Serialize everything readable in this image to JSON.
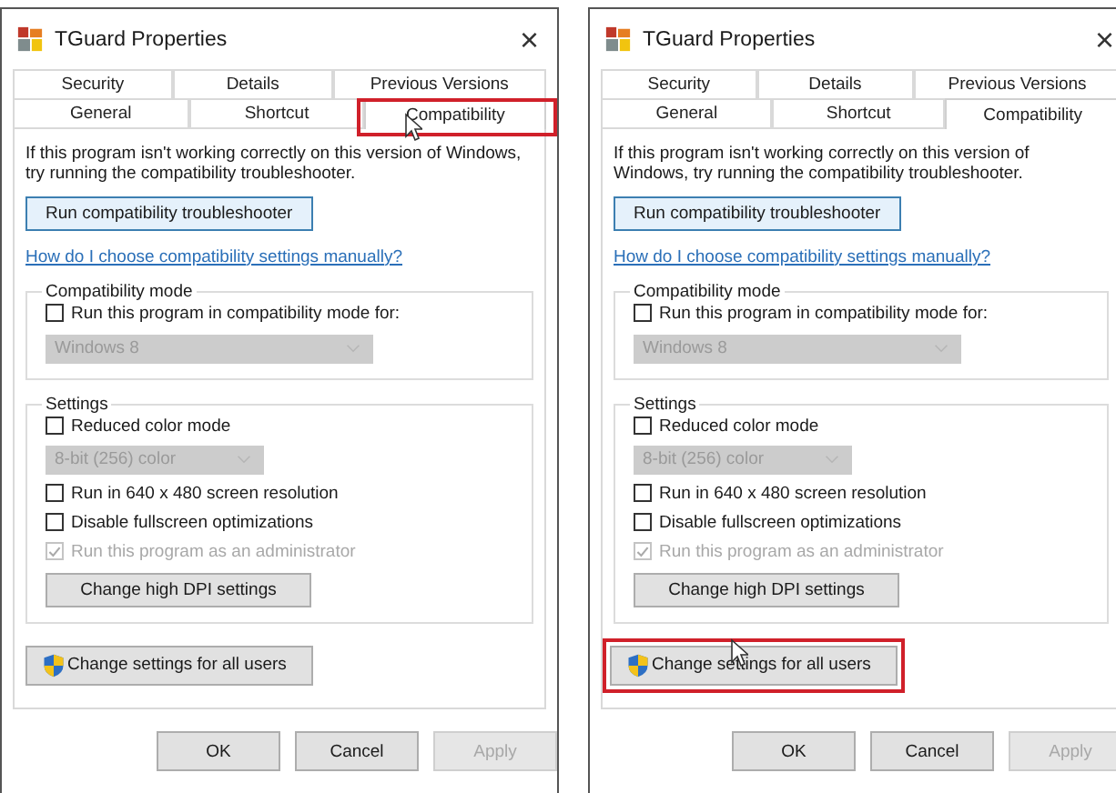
{
  "dialogs": [
    {
      "title": "TGuard Properties",
      "close": "×",
      "tab_rows": [
        [
          {
            "label": "Security",
            "selected": false,
            "highlighted": false
          },
          {
            "label": "Details",
            "selected": false,
            "highlighted": false
          },
          {
            "label": "Previous Versions",
            "selected": false,
            "highlighted": false
          }
        ],
        [
          {
            "label": "General",
            "selected": false,
            "highlighted": false
          },
          {
            "label": "Shortcut",
            "selected": false,
            "highlighted": false
          },
          {
            "label": "Compatibility",
            "selected": true,
            "highlighted": true
          }
        ]
      ],
      "intro": "If this program isn't working correctly on this version of Windows, try running the compatibility troubleshooter.",
      "troubleshoot_button": "Run compatibility troubleshooter",
      "help_link": "How do I choose compatibility settings manually?",
      "compat_group": {
        "legend": "Compatibility mode",
        "items": [
          {
            "kind": "checkbox",
            "label": "Run this program in compatibility mode for:",
            "checked": false,
            "disabled": false
          },
          {
            "kind": "dropdown",
            "value": "Windows 8",
            "disabled": true
          }
        ]
      },
      "settings_group": {
        "legend": "Settings",
        "items": [
          {
            "kind": "checkbox",
            "label": "Reduced color mode",
            "checked": false,
            "disabled": false
          },
          {
            "kind": "dropdown",
            "value": "8-bit (256) color",
            "disabled": true
          },
          {
            "kind": "checkbox",
            "label": "Run in 640 x 480 screen resolution",
            "checked": false,
            "disabled": false
          },
          {
            "kind": "checkbox",
            "label": "Disable fullscreen optimizations",
            "checked": false,
            "disabled": false
          },
          {
            "kind": "checkbox",
            "label": "Run this program as an administrator",
            "checked": true,
            "disabled": true
          },
          {
            "kind": "button",
            "label": "Change high DPI settings"
          }
        ]
      },
      "all_users_button": {
        "label": "Change settings for all users",
        "highlighted": false
      },
      "footer_buttons": [
        {
          "label": "OK",
          "disabled": false
        },
        {
          "label": "Cancel",
          "disabled": false
        },
        {
          "label": "Apply",
          "disabled": true
        }
      ]
    },
    {
      "title": "TGuard Properties",
      "close": "×",
      "tab_rows": [
        [
          {
            "label": "Security",
            "selected": false,
            "highlighted": false
          },
          {
            "label": "Details",
            "selected": false,
            "highlighted": false
          },
          {
            "label": "Previous Versions",
            "selected": false,
            "highlighted": false
          }
        ],
        [
          {
            "label": "General",
            "selected": false,
            "highlighted": false
          },
          {
            "label": "Shortcut",
            "selected": false,
            "highlighted": false
          },
          {
            "label": "Compatibility",
            "selected": true,
            "highlighted": false
          }
        ]
      ],
      "intro": "If this program isn't working correctly on this version of Windows, try running the compatibility troubleshooter.",
      "troubleshoot_button": "Run compatibility troubleshooter",
      "help_link": "How do I choose compatibility settings manually?",
      "compat_group": {
        "legend": "Compatibility mode",
        "items": [
          {
            "kind": "checkbox",
            "label": "Run this program in compatibility mode for:",
            "checked": false,
            "disabled": false
          },
          {
            "kind": "dropdown",
            "value": "Windows 8",
            "disabled": true
          }
        ]
      },
      "settings_group": {
        "legend": "Settings",
        "items": [
          {
            "kind": "checkbox",
            "label": "Reduced color mode",
            "checked": false,
            "disabled": false
          },
          {
            "kind": "dropdown",
            "value": "8-bit (256) color",
            "disabled": true
          },
          {
            "kind": "checkbox",
            "label": "Run in 640 x 480 screen resolution",
            "checked": false,
            "disabled": false
          },
          {
            "kind": "checkbox",
            "label": "Disable fullscreen optimizations",
            "checked": false,
            "disabled": false
          },
          {
            "kind": "checkbox",
            "label": "Run this program as an administrator",
            "checked": true,
            "disabled": true
          },
          {
            "kind": "button",
            "label": "Change high DPI settings"
          }
        ]
      },
      "all_users_button": {
        "label": "Change settings for all users",
        "highlighted": true
      },
      "footer_buttons": [
        {
          "label": "OK",
          "disabled": false
        },
        {
          "label": "Cancel",
          "disabled": false
        },
        {
          "label": "Apply",
          "disabled": true
        }
      ]
    }
  ]
}
